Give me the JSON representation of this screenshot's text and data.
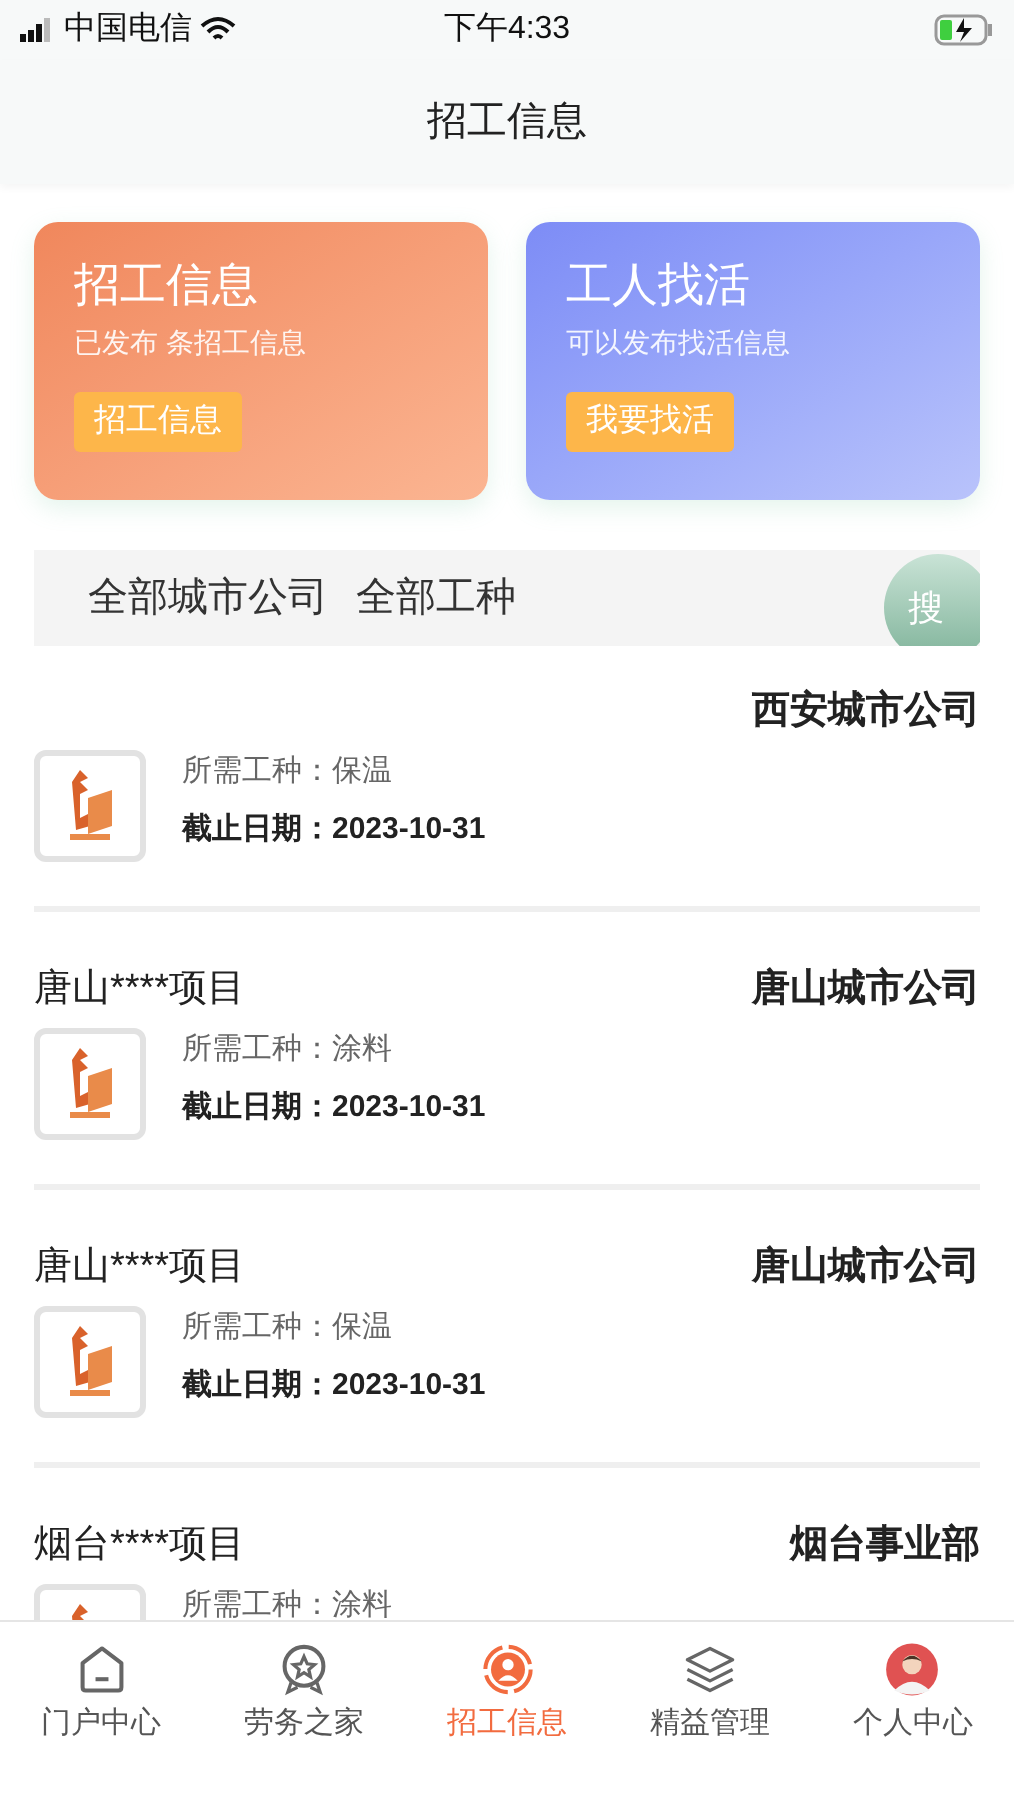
{
  "status_bar": {
    "carrier": "中国电信",
    "time": "下午4:33"
  },
  "header": {
    "title": "招工信息"
  },
  "cards": [
    {
      "kind": "orange",
      "title": "招工信息",
      "subtitle": "已发布 条招工信息",
      "button": "招工信息"
    },
    {
      "kind": "blue",
      "title": "工人找活",
      "subtitle": "可以发布找活信息",
      "button": "我要找活"
    }
  ],
  "filter": {
    "city": "全部城市公司",
    "trade": "全部工种",
    "search": "搜"
  },
  "jobs": [
    {
      "company": "西安城市公司",
      "trade": "所需工种：保温",
      "deadline": "截止日期：2023-10-31"
    },
    {
      "title": "唐山****项目",
      "company": "唐山城市公司",
      "trade": "所需工种：涂料",
      "deadline": "截止日期：2023-10-31"
    },
    {
      "title": "唐山****项目",
      "company": "唐山城市公司",
      "trade": "所需工种：保温",
      "deadline": "截止日期：2023-10-31"
    },
    {
      "title": "烟台****项目",
      "company": "烟台事业部",
      "trade": "所需工种：涂料"
    }
  ],
  "tabs": [
    {
      "kind": "home",
      "label": "门户中心",
      "selected": false
    },
    {
      "kind": "badge",
      "label": "劳务之家",
      "selected": false
    },
    {
      "kind": "worker",
      "label": "招工信息",
      "selected": true
    },
    {
      "kind": "layers",
      "label": "精益管理",
      "selected": false
    },
    {
      "kind": "avatar",
      "label": "个人中心",
      "selected": false
    }
  ]
}
